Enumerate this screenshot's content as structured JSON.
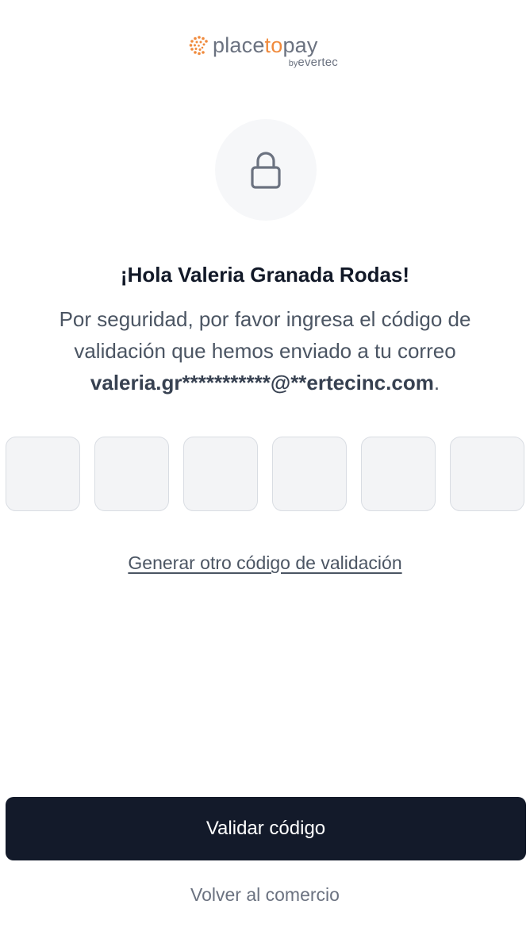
{
  "logo": {
    "part1": "place",
    "part2": "to",
    "part3": "pay",
    "by": "by",
    "brand": "evertec"
  },
  "icons": {
    "lock": "lock-icon",
    "logo_mark": "placetopay-dots-logo"
  },
  "greeting": "¡Hola Valeria Granada Rodas!",
  "message": {
    "text": "Por seguridad, por favor ingresa el código de validación que hemos enviado a tu correo",
    "email": "valeria.gr***********@**ertecinc.com",
    "period": "."
  },
  "code_inputs": [
    "",
    "",
    "",
    "",
    "",
    ""
  ],
  "regenerate_link": "Generar otro código de validación",
  "validate_button": "Validar código",
  "back_link": "Volver al comercio",
  "colors": {
    "accent": "#f08a3c",
    "primary_button": "#131a2a",
    "text_dark": "#111827",
    "text_muted": "#4b5563"
  }
}
